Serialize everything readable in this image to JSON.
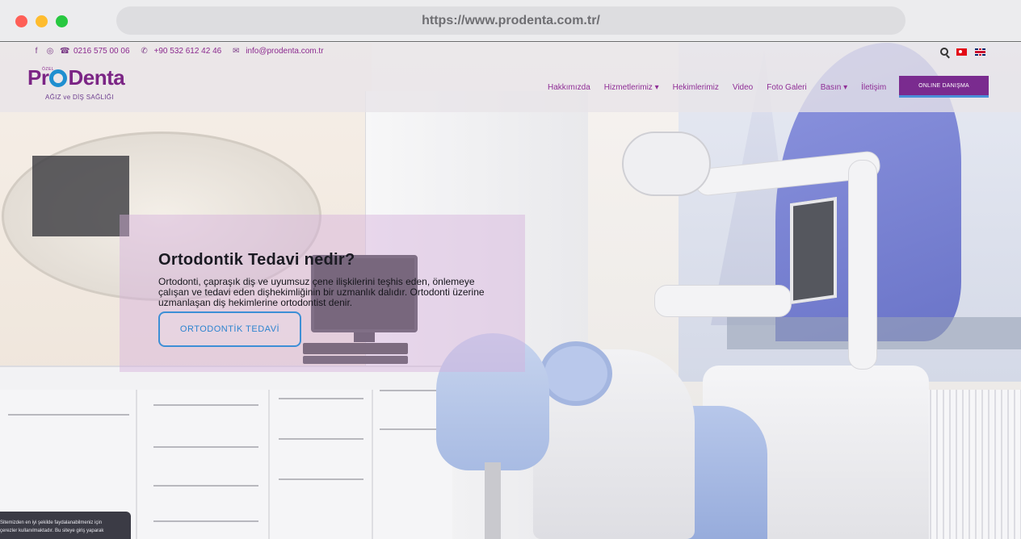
{
  "browser": {
    "url": "https://www.prodenta.com.tr/"
  },
  "topbar": {
    "phone": "0216 575 00 06",
    "whatsapp": "+90 532 612 42 46",
    "email": "info@prodenta.com.tr"
  },
  "logo": {
    "ozel": "ÖZEL",
    "pr": "Pr",
    "denta": "Denta",
    "tagline": "AĞIZ ve DİŞ SAĞLIĞI"
  },
  "nav": {
    "items": [
      {
        "label": "Hakkımızda"
      },
      {
        "label": "Hizmetlerimiz ▾"
      },
      {
        "label": "Hekimlerimiz"
      },
      {
        "label": "Video"
      },
      {
        "label": "Foto Galeri"
      },
      {
        "label": "Basın ▾"
      },
      {
        "label": "İletişim"
      }
    ],
    "cta": "ONLINE DANIŞMA"
  },
  "hero": {
    "title": "Ortodontik Tedavi nedir?",
    "text": "Ortodonti, çapraşık diş ve uyumsuz çene ilişkilerini teşhis eden, önlemeye çalışan ve tedavi eden dişhekimliğinin bir uzmanlık dalıdır. Ortodonti üzerine uzmanlaşan diş hekimlerine ortodontist denir.",
    "button": "ORTODONTİK TEDAVİ"
  },
  "cookie": {
    "line1": "Sitemizden en iyi şekilde faydalanabilmeniz için",
    "line2": "çerezler kullanılmaktadır. Bu siteye giriş yaparak"
  },
  "colors": {
    "brand": "#7a2b8f",
    "accent": "#3d8fd6"
  }
}
